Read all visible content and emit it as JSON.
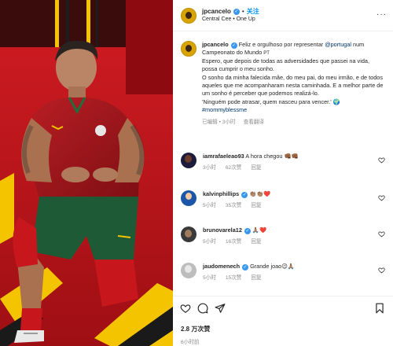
{
  "header": {
    "username": "jpcancelo",
    "dot": "•",
    "follow_label": "关注",
    "music": "Central Cee • One Up",
    "more": "···"
  },
  "caption": {
    "username": "jpcancelo",
    "text_before_link": "Feliz e orgulhoso por representar ",
    "link": "@portugal",
    "text_after_link": " num Campeonato do Mundo ",
    "flag": "PT",
    "p1": "Espero, que depois de todas as adversidades que passei na vida, possa cumprir o meu sonho.",
    "p2": "O sonho da minha falecida mãe, do meu pai, do meu irmão, e de todos aqueles que me acompanharam nesta caminhada. E a melhor parte de um sonho é perceber que podemos realizá-lo.",
    "p3": "'Ninguém pode atrasar, quem nasceu para vencer.' ",
    "hashtag": "#mommyblessme",
    "edited": "已编辑",
    "dot": "•",
    "time": "3小时",
    "translate": "查看翻译"
  },
  "comments": [
    {
      "username": "iamrafaeleao93",
      "text": "A hora chegou 👊🏾👊🏾",
      "time": "3小时",
      "likes": "62次赞",
      "reply": "回复",
      "verified": false
    },
    {
      "username": "kalvinphillips",
      "text": "👏🏽👏🏽❤️",
      "time": "5小时",
      "likes": "35次赞",
      "reply": "回复",
      "verified": true
    },
    {
      "username": "brunovarela12",
      "text": "🙏🏽❤️",
      "time": "5小时",
      "likes": "16次赞",
      "reply": "回复",
      "verified": true
    },
    {
      "username": "jaudomenech",
      "text": "Grande joao😉🙏🏽",
      "time": "5小时",
      "likes": "15次赞",
      "reply": "回复",
      "verified": true
    }
  ],
  "footer": {
    "likes": "2.8 万次赞",
    "time": "6小时前"
  },
  "colors": {
    "accent": "#0095f6",
    "verified": "#3897f0",
    "muted": "#8e8e8e",
    "photo_red": "#c8161d"
  }
}
